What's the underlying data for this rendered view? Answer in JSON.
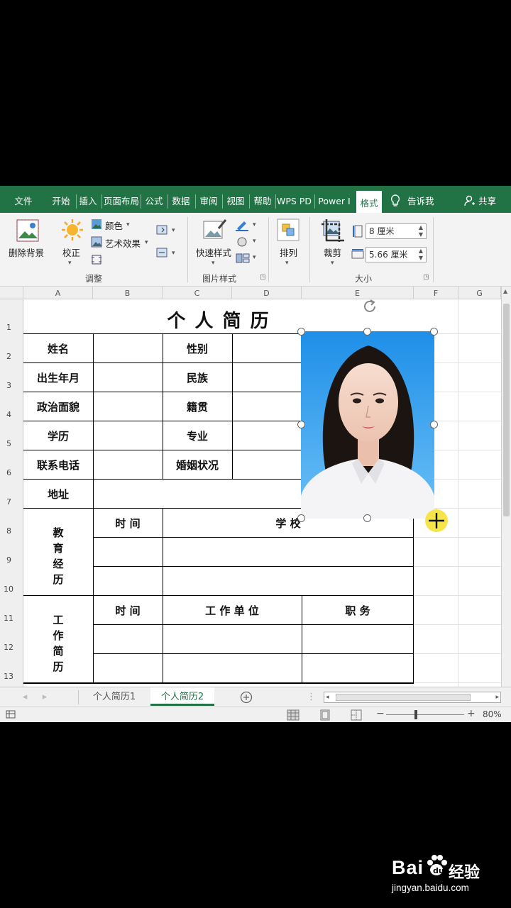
{
  "ribbon_tabs": [
    {
      "label": "文件"
    },
    {
      "label": "开始"
    },
    {
      "label": "插入"
    },
    {
      "label": "页面布局"
    },
    {
      "label": "公式"
    },
    {
      "label": "数据"
    },
    {
      "label": "审阅"
    },
    {
      "label": "视图"
    },
    {
      "label": "帮助"
    },
    {
      "label": "WPS PDF"
    },
    {
      "label": "Power I"
    },
    {
      "label": "格式"
    }
  ],
  "tell_me": "告诉我",
  "share": "共享",
  "ribbon": {
    "remove_background": "删除背景",
    "corrections": "校正",
    "color": "颜色",
    "artistic_effects": "艺术效果",
    "adjust_group": "调整",
    "quick_styles": "快速样式",
    "picture_styles_group": "图片样式",
    "arrange": "排列",
    "crop": "裁剪",
    "height_value": "8 厘米",
    "width_value": "5.66 厘米",
    "size_group": "大小"
  },
  "columns": [
    "A",
    "B",
    "C",
    "D",
    "E",
    "F",
    "G"
  ],
  "rows": [
    "1",
    "2",
    "3",
    "4",
    "5",
    "6",
    "7",
    "8",
    "9",
    "10",
    "11",
    "12",
    "13"
  ],
  "resume": {
    "title": "个 人 简 历",
    "name": "姓名",
    "gender": "性别",
    "birth": "出生年月",
    "ethnicity": "民族",
    "political": "政治面貌",
    "hometown": "籍贯",
    "education": "学历",
    "major": "专业",
    "phone": "联系电话",
    "marital": "婚姻状况",
    "address": "地址",
    "edu_exp": [
      "教",
      "育",
      "经",
      "历"
    ],
    "time": "时 间",
    "school": "学  校",
    "work_exp": [
      "工",
      "作",
      "简",
      "历"
    ],
    "work_time": "时 间",
    "employer": "工 作 单 位",
    "position": "职 务"
  },
  "sheets": [
    "个人简历1",
    "个人简历2"
  ],
  "zoom": "80%",
  "watermark": {
    "brand": "Bai",
    "brand2": "经验",
    "url": "jingyan.baidu.com"
  },
  "colors": {
    "excel_green": "#217346",
    "photo_bg": "#2a9bee"
  }
}
